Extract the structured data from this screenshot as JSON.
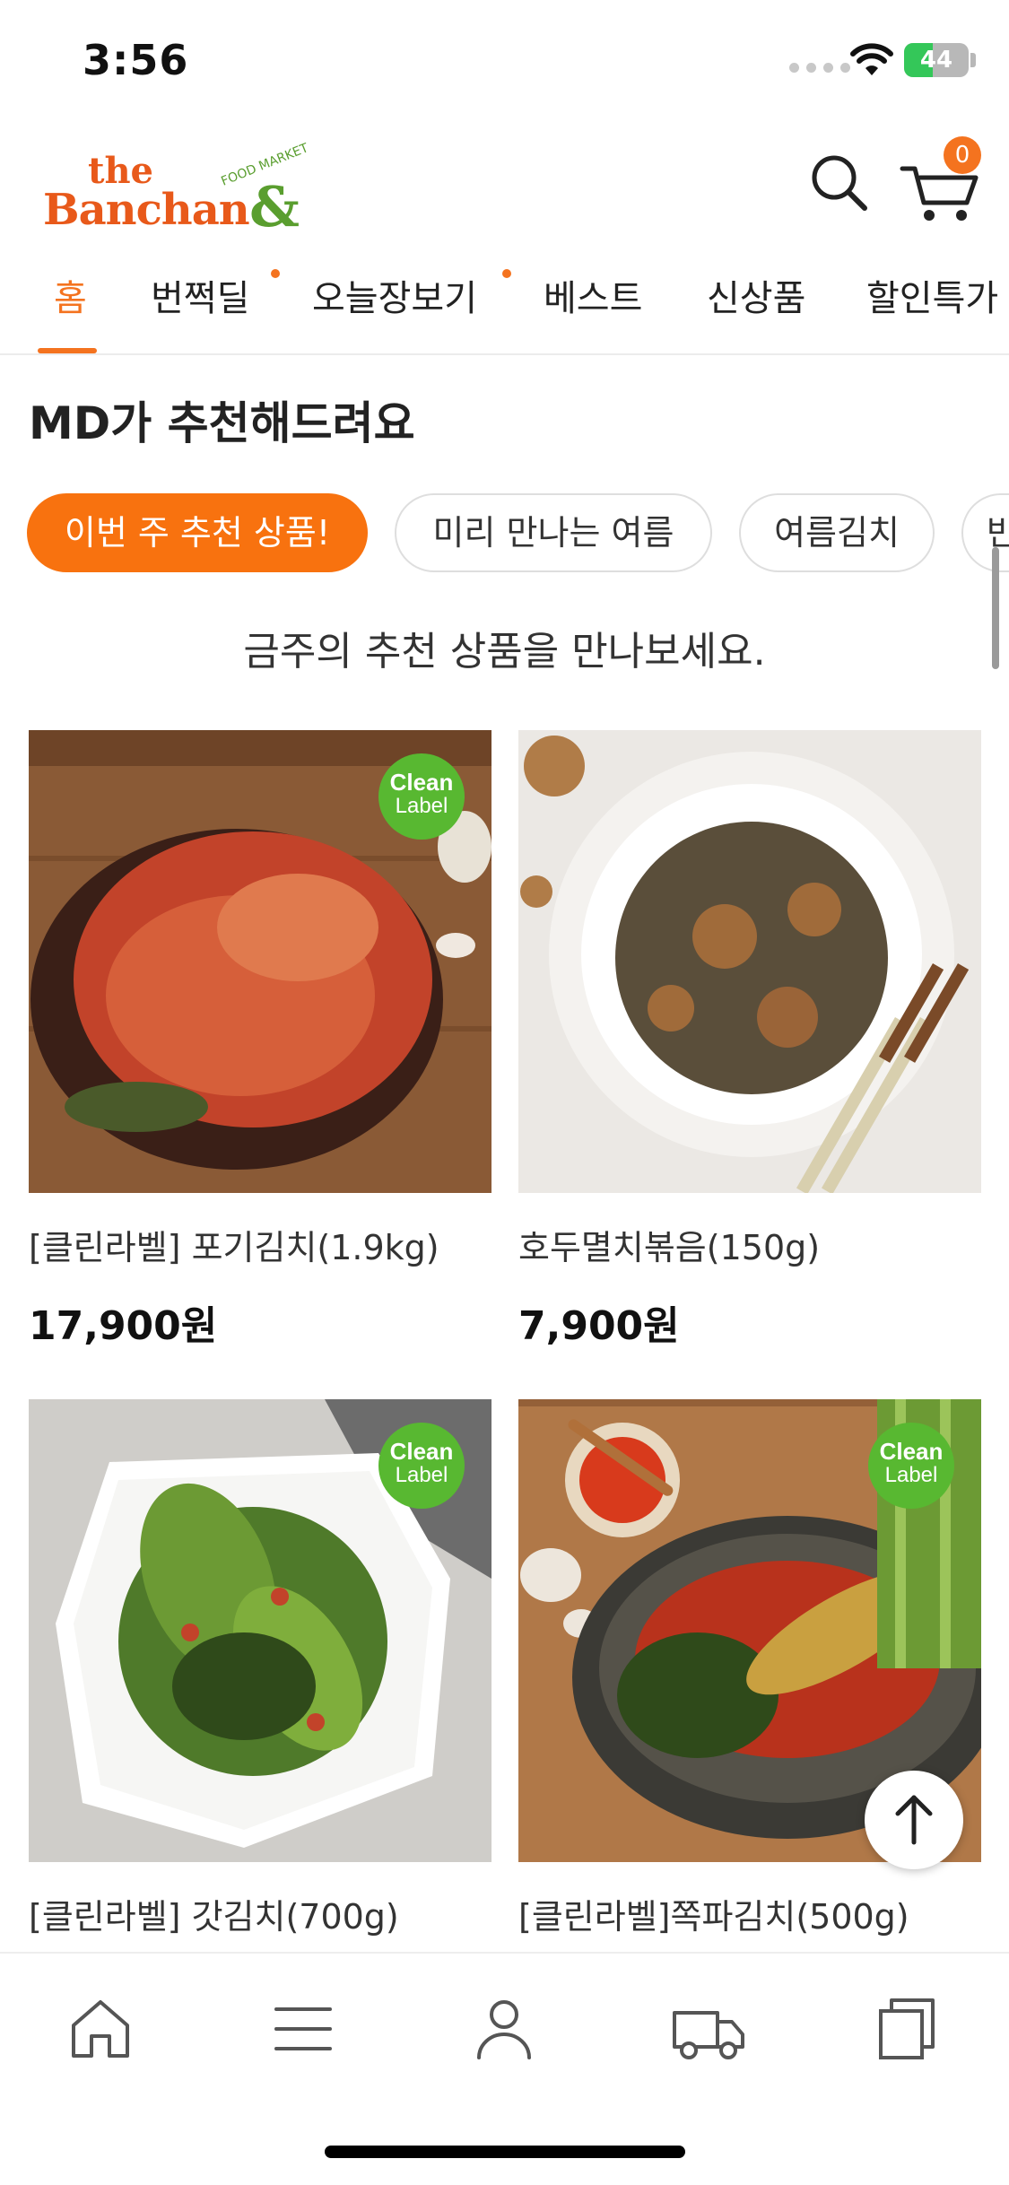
{
  "status_bar": {
    "time": "3:56",
    "battery_level": "44",
    "battery_fraction": 0.44
  },
  "header": {
    "logo_text": "the Banchan&",
    "logo_tagline": "FOOD MARKET",
    "cart_count": "0"
  },
  "tabs": [
    {
      "label": "홈",
      "active": true,
      "dot": false
    },
    {
      "label": "번쩍딜",
      "active": false,
      "dot": true
    },
    {
      "label": "오늘장보기",
      "active": false,
      "dot": true
    },
    {
      "label": "베스트",
      "active": false,
      "dot": false
    },
    {
      "label": "신상품",
      "active": false,
      "dot": false
    },
    {
      "label": "할인특가",
      "active": false,
      "dot": false
    }
  ],
  "section": {
    "title": "MD가 추천해드려요",
    "subtitle": "금주의 추천 상품을 만나보세요.",
    "chips": [
      {
        "label": "이번 주 추천 상품!",
        "active": true
      },
      {
        "label": "미리 만나는 여름",
        "active": false
      },
      {
        "label": "여름김치",
        "active": false
      },
      {
        "label": "반",
        "active": false
      }
    ]
  },
  "badge": {
    "line1": "Clean",
    "line2": "Label"
  },
  "products": [
    {
      "name": "[클린라벨] 포기김치(1.9kg)",
      "price": "17,900원",
      "clean_label": true,
      "image": "kimchi-cabbage"
    },
    {
      "name": "호두멸치볶음(150g)",
      "price": "7,900원",
      "clean_label": false,
      "image": "anchovy-walnut"
    },
    {
      "name": "[클린라벨] 갓김치(700g)",
      "price": "",
      "clean_label": true,
      "image": "mustard-greens-kimchi"
    },
    {
      "name": "[클린라벨]쪽파김치(500g)",
      "price": "",
      "clean_label": true,
      "image": "green-onion-kimchi"
    }
  ],
  "bottom_nav": [
    {
      "name": "home",
      "icon": "home-icon"
    },
    {
      "name": "menu",
      "icon": "menu-icon"
    },
    {
      "name": "my-page",
      "icon": "user-icon"
    },
    {
      "name": "delivery",
      "icon": "truck-icon"
    },
    {
      "name": "recent",
      "icon": "copy-icon"
    }
  ],
  "colors": {
    "accent": "#f4731f",
    "clean_badge": "#58b831",
    "battery_green": "#34c759"
  }
}
